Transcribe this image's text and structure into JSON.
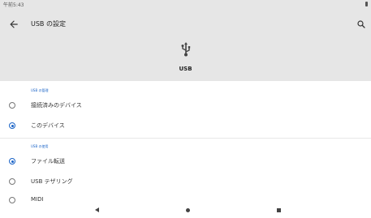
{
  "status_bar": {
    "time": "午前5:43"
  },
  "app_bar": {
    "title": "USB の設定"
  },
  "header": {
    "label": "USB"
  },
  "sections": [
    {
      "label": "USB の管理",
      "options": [
        {
          "label": "接続済みのデバイス",
          "selected": false
        },
        {
          "label": "このデバイス",
          "selected": true
        }
      ]
    },
    {
      "label": "USB の使用",
      "options": [
        {
          "label": "ファイル転送",
          "selected": true
        },
        {
          "label": "USB テザリング",
          "selected": false
        },
        {
          "label": "MIDI",
          "selected": false
        }
      ]
    }
  ],
  "colors": {
    "accent": "#1a63c7",
    "app_bar_bg": "#e6e6e6"
  },
  "icons": [
    "back-arrow-icon",
    "search-icon",
    "usb-icon",
    "nav-back-icon",
    "nav-home-icon",
    "nav-recents-icon"
  ]
}
